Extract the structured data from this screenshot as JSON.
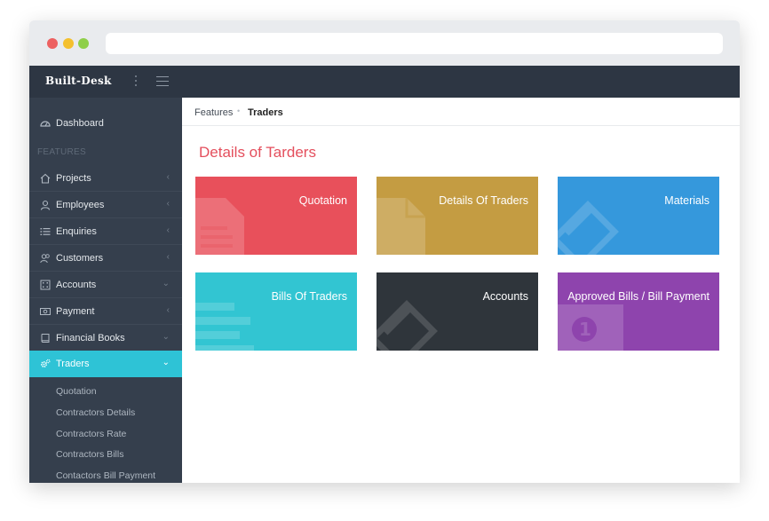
{
  "app": {
    "brand": "Built-Desk"
  },
  "breadcrumb": {
    "parent": "Features",
    "separator": "•",
    "current": "Traders"
  },
  "page": {
    "heading": "Details of Tarders"
  },
  "sidebar": {
    "dashboard": "Dashboard",
    "section_label": "FEATURES",
    "items": [
      {
        "label": "Projects",
        "icon": "home-icon",
        "chevron": "‹"
      },
      {
        "label": "Employees",
        "icon": "user-icon",
        "chevron": "‹"
      },
      {
        "label": "Enquiries",
        "icon": "list-icon",
        "chevron": "‹"
      },
      {
        "label": "Customers",
        "icon": "users-icon",
        "chevron": "‹"
      },
      {
        "label": "Accounts",
        "icon": "calculator-icon",
        "chevron": "⌄"
      },
      {
        "label": "Payment",
        "icon": "money-icon",
        "chevron": "‹"
      },
      {
        "label": "Financial Books",
        "icon": "book-icon",
        "chevron": "⌄"
      },
      {
        "label": "Traders",
        "icon": "cogs-icon",
        "chevron": "⌄",
        "active": true
      }
    ],
    "subitems": [
      "Quotation",
      "Contractors Details",
      "Contractors Rate",
      "Contractors Bills",
      "Contactors Bill Payment"
    ]
  },
  "tiles": [
    {
      "label": "Quotation",
      "color": "#e8505b",
      "icon": "document-icon"
    },
    {
      "label": "Details Of Traders",
      "color": "#c49c42",
      "icon": "document-icon"
    },
    {
      "label": "Materials",
      "color": "#3598dc",
      "icon": "ticket-icon"
    },
    {
      "label": "Bills Of Traders",
      "color": "#32c5d2",
      "icon": "list-icon"
    },
    {
      "label": "Accounts",
      "color": "#2f353b",
      "icon": "ticket-icon"
    },
    {
      "label": "Approved Bills / Bill Payment",
      "color": "#8e44ad",
      "icon": "money-icon"
    }
  ],
  "colors": {
    "topbar": "#2d3643",
    "sidebar": "#353f4d",
    "active": "#2ec3d6",
    "heading": "#e44f5d"
  }
}
